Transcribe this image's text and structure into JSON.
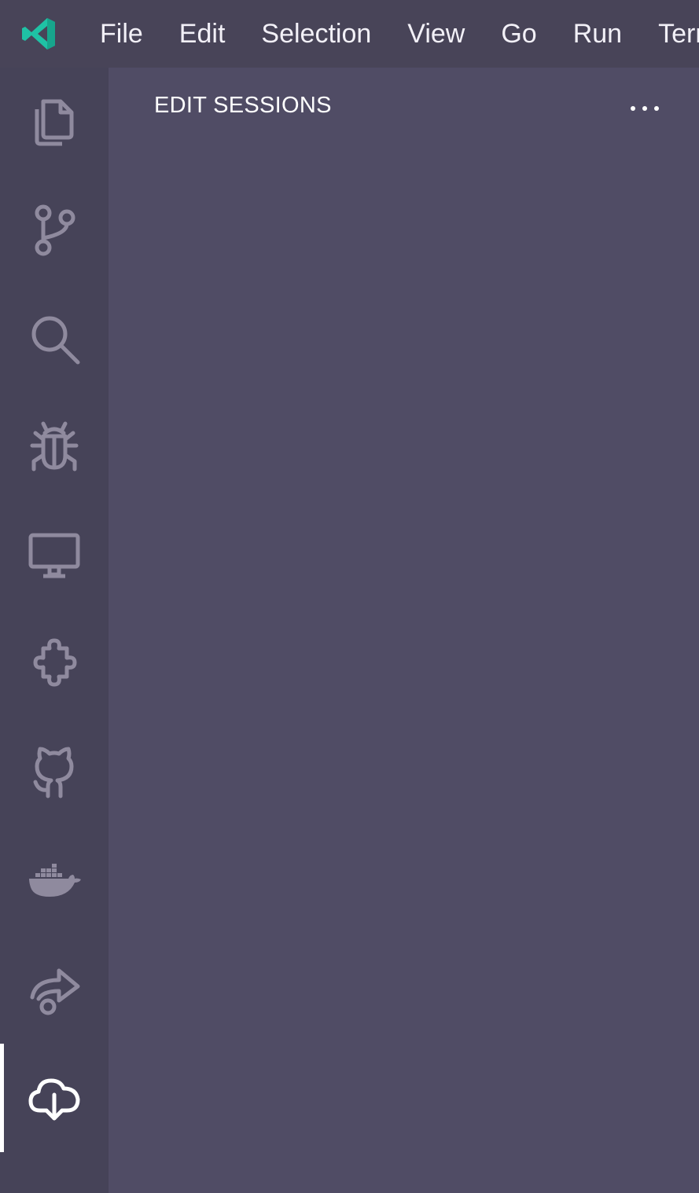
{
  "theme": {
    "accent": "#1fc2a5",
    "icon_inactive": "#8f8a9e",
    "icon_active": "#ffffff",
    "titlebar_bg": "#484458",
    "activitybar_bg": "#464358",
    "sidebar_bg": "#504c65"
  },
  "titlebar": {
    "logo_icon": "vscode-logo-icon",
    "menu": [
      "File",
      "Edit",
      "Selection",
      "View",
      "Go",
      "Run",
      "Terminal"
    ]
  },
  "activitybar": {
    "items": [
      {
        "icon": "explorer-files-icon",
        "active": false
      },
      {
        "icon": "source-control-icon",
        "active": false
      },
      {
        "icon": "search-icon",
        "active": false
      },
      {
        "icon": "run-debug-bug-icon",
        "active": false
      },
      {
        "icon": "remote-explorer-monitor-icon",
        "active": false
      },
      {
        "icon": "extensions-puzzle-icon",
        "active": false
      },
      {
        "icon": "github-icon",
        "active": false
      },
      {
        "icon": "docker-whale-icon",
        "active": false
      },
      {
        "icon": "live-share-icon",
        "active": false
      },
      {
        "icon": "edit-sessions-cloud-icon",
        "active": true
      }
    ]
  },
  "sidebar": {
    "title": "EDIT SESSIONS",
    "more_actions_icon": "ellipsis-icon"
  }
}
